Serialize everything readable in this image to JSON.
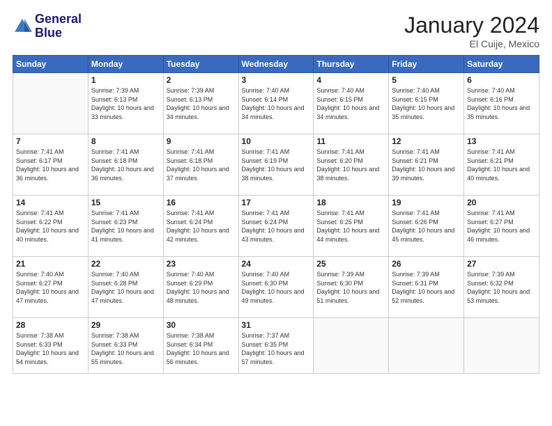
{
  "header": {
    "logo_line1": "General",
    "logo_line2": "Blue",
    "month": "January 2024",
    "location": "El Cuije, Mexico"
  },
  "weekdays": [
    "Sunday",
    "Monday",
    "Tuesday",
    "Wednesday",
    "Thursday",
    "Friday",
    "Saturday"
  ],
  "weeks": [
    [
      {
        "day": "",
        "sunrise": "",
        "sunset": "",
        "daylight": ""
      },
      {
        "day": "1",
        "sunrise": "7:39 AM",
        "sunset": "6:13 PM",
        "daylight": "10 hours and 33 minutes."
      },
      {
        "day": "2",
        "sunrise": "7:39 AM",
        "sunset": "6:13 PM",
        "daylight": "10 hours and 34 minutes."
      },
      {
        "day": "3",
        "sunrise": "7:40 AM",
        "sunset": "6:14 PM",
        "daylight": "10 hours and 34 minutes."
      },
      {
        "day": "4",
        "sunrise": "7:40 AM",
        "sunset": "6:15 PM",
        "daylight": "10 hours and 34 minutes."
      },
      {
        "day": "5",
        "sunrise": "7:40 AM",
        "sunset": "6:15 PM",
        "daylight": "10 hours and 35 minutes."
      },
      {
        "day": "6",
        "sunrise": "7:40 AM",
        "sunset": "6:16 PM",
        "daylight": "10 hours and 35 minutes."
      }
    ],
    [
      {
        "day": "7",
        "sunrise": "7:41 AM",
        "sunset": "6:17 PM",
        "daylight": "10 hours and 36 minutes."
      },
      {
        "day": "8",
        "sunrise": "7:41 AM",
        "sunset": "6:18 PM",
        "daylight": "10 hours and 36 minutes."
      },
      {
        "day": "9",
        "sunrise": "7:41 AM",
        "sunset": "6:18 PM",
        "daylight": "10 hours and 37 minutes."
      },
      {
        "day": "10",
        "sunrise": "7:41 AM",
        "sunset": "6:19 PM",
        "daylight": "10 hours and 38 minutes."
      },
      {
        "day": "11",
        "sunrise": "7:41 AM",
        "sunset": "6:20 PM",
        "daylight": "10 hours and 38 minutes."
      },
      {
        "day": "12",
        "sunrise": "7:41 AM",
        "sunset": "6:21 PM",
        "daylight": "10 hours and 39 minutes."
      },
      {
        "day": "13",
        "sunrise": "7:41 AM",
        "sunset": "6:21 PM",
        "daylight": "10 hours and 40 minutes."
      }
    ],
    [
      {
        "day": "14",
        "sunrise": "7:41 AM",
        "sunset": "6:22 PM",
        "daylight": "10 hours and 40 minutes."
      },
      {
        "day": "15",
        "sunrise": "7:41 AM",
        "sunset": "6:23 PM",
        "daylight": "10 hours and 41 minutes."
      },
      {
        "day": "16",
        "sunrise": "7:41 AM",
        "sunset": "6:24 PM",
        "daylight": "10 hours and 42 minutes."
      },
      {
        "day": "17",
        "sunrise": "7:41 AM",
        "sunset": "6:24 PM",
        "daylight": "10 hours and 43 minutes."
      },
      {
        "day": "18",
        "sunrise": "7:41 AM",
        "sunset": "6:25 PM",
        "daylight": "10 hours and 44 minutes."
      },
      {
        "day": "19",
        "sunrise": "7:41 AM",
        "sunset": "6:26 PM",
        "daylight": "10 hours and 45 minutes."
      },
      {
        "day": "20",
        "sunrise": "7:41 AM",
        "sunset": "6:27 PM",
        "daylight": "10 hours and 46 minutes."
      }
    ],
    [
      {
        "day": "21",
        "sunrise": "7:40 AM",
        "sunset": "6:27 PM",
        "daylight": "10 hours and 47 minutes."
      },
      {
        "day": "22",
        "sunrise": "7:40 AM",
        "sunset": "6:28 PM",
        "daylight": "10 hours and 47 minutes."
      },
      {
        "day": "23",
        "sunrise": "7:40 AM",
        "sunset": "6:29 PM",
        "daylight": "10 hours and 48 minutes."
      },
      {
        "day": "24",
        "sunrise": "7:40 AM",
        "sunset": "6:30 PM",
        "daylight": "10 hours and 49 minutes."
      },
      {
        "day": "25",
        "sunrise": "7:39 AM",
        "sunset": "6:30 PM",
        "daylight": "10 hours and 51 minutes."
      },
      {
        "day": "26",
        "sunrise": "7:39 AM",
        "sunset": "6:31 PM",
        "daylight": "10 hours and 52 minutes."
      },
      {
        "day": "27",
        "sunrise": "7:39 AM",
        "sunset": "6:32 PM",
        "daylight": "10 hours and 53 minutes."
      }
    ],
    [
      {
        "day": "28",
        "sunrise": "7:38 AM",
        "sunset": "6:33 PM",
        "daylight": "10 hours and 54 minutes."
      },
      {
        "day": "29",
        "sunrise": "7:38 AM",
        "sunset": "6:33 PM",
        "daylight": "10 hours and 55 minutes."
      },
      {
        "day": "30",
        "sunrise": "7:38 AM",
        "sunset": "6:34 PM",
        "daylight": "10 hours and 56 minutes."
      },
      {
        "day": "31",
        "sunrise": "7:37 AM",
        "sunset": "6:35 PM",
        "daylight": "10 hours and 57 minutes."
      },
      {
        "day": "",
        "sunrise": "",
        "sunset": "",
        "daylight": ""
      },
      {
        "day": "",
        "sunrise": "",
        "sunset": "",
        "daylight": ""
      },
      {
        "day": "",
        "sunrise": "",
        "sunset": "",
        "daylight": ""
      }
    ]
  ]
}
